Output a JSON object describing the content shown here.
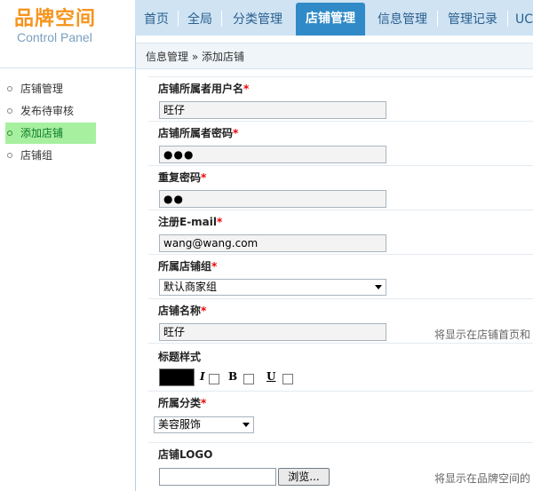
{
  "logo": {
    "brand": "品牌空间",
    "subtitle": "Control Panel"
  },
  "topnav": {
    "tabs": [
      {
        "label": "首页"
      },
      {
        "label": "全局"
      },
      {
        "label": "分类管理"
      },
      {
        "label": "店铺管理"
      },
      {
        "label": "信息管理"
      },
      {
        "label": "管理记录"
      },
      {
        "label": "UC"
      }
    ],
    "active": "店铺管理"
  },
  "sidebar": {
    "items": [
      {
        "label": "店铺管理"
      },
      {
        "label": "发布待审核"
      },
      {
        "label": "添加店铺"
      },
      {
        "label": "店铺组"
      }
    ],
    "active": "添加店铺"
  },
  "breadcrumb": {
    "text": "信息管理 » 添加店铺"
  },
  "form": {
    "required_mark": "*",
    "owner_username": {
      "label": "店铺所属者用户名",
      "value": "旺仔"
    },
    "owner_password": {
      "label": "店铺所属者密码",
      "value": "●●●"
    },
    "repeat_password": {
      "label": "重复密码",
      "value": "●●"
    },
    "email": {
      "label": "注册E-mail",
      "value": "wang@wang.com"
    },
    "shop_group": {
      "label": "所属店铺组",
      "selected": "默认商家组"
    },
    "shop_name": {
      "label": "店铺名称",
      "value": "旺仔",
      "hint": "将显示在店铺首页和"
    },
    "title_style": {
      "label": "标题样式",
      "italic": "I",
      "bold": "B",
      "underline": "U"
    },
    "category": {
      "label": "所属分类",
      "selected": "美容服饰"
    },
    "logo": {
      "label": "店铺LOGO",
      "browse_label": "浏览...",
      "hint": "将显示在品牌空间的"
    }
  },
  "colors": {
    "active_tab": "#2f8ac7",
    "nav_bg": "#cfe3f3",
    "sidebar_active": "#a6f0a0",
    "brand": "#f7941d"
  }
}
